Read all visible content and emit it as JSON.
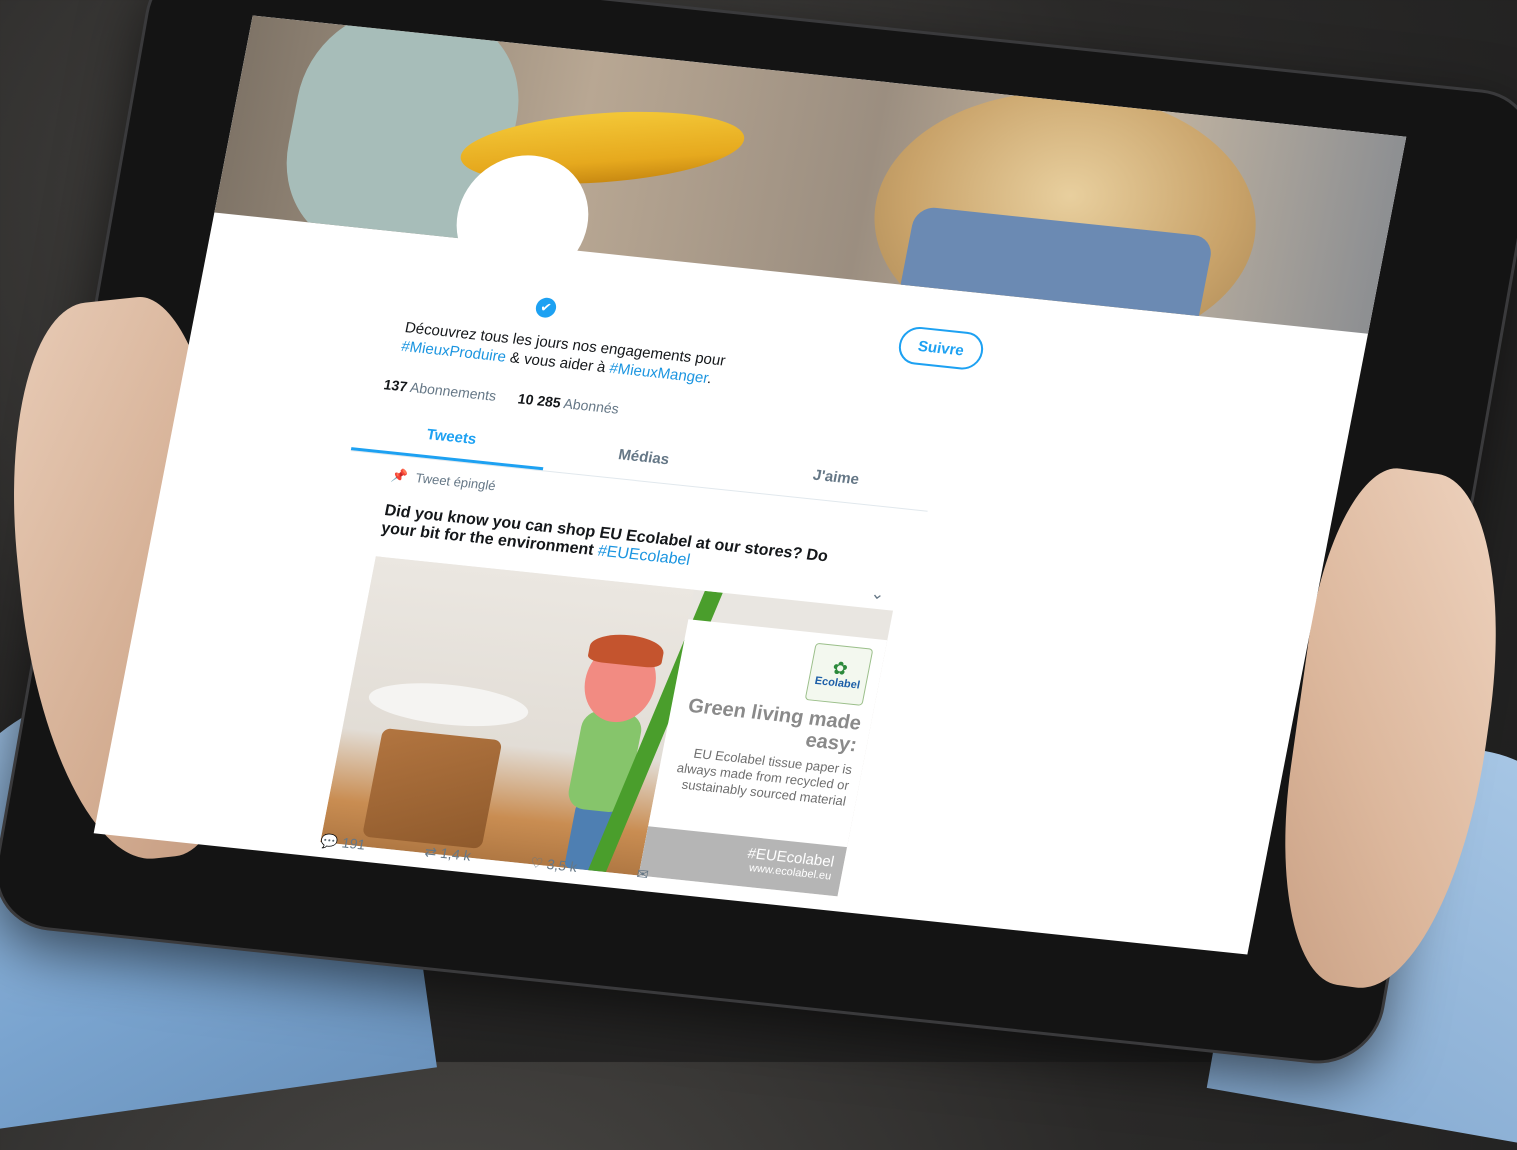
{
  "profile": {
    "follow_label": "Suivre",
    "verified_icon": "✔",
    "bio_line1": "Découvrez tous les jours nos engagements pour",
    "bio_hashtag1": "#MieuxProduire",
    "bio_mid": " & vous aider à ",
    "bio_hashtag2": "#MieuxManger",
    "bio_end": ".",
    "following_count": "137",
    "following_label": "Abonnements",
    "followers_count": "10 285",
    "followers_label": "Abonnés"
  },
  "tabs": [
    {
      "label": "Tweets",
      "active": true
    },
    {
      "label": "Médias",
      "active": false
    },
    {
      "label": "J'aime",
      "active": false
    }
  ],
  "pinned_label": "Tweet épinglé",
  "tweet": {
    "text": "Did you know you can shop EU Ecolabel at our stores? Do your bit for the environment",
    "hashtag": "#EUEcolabel",
    "media": {
      "logo_text": "Ecolabel",
      "headline": "Green living made easy:",
      "body": "EU Ecolabel tissue paper is always made from recycled or sustainably sourced material",
      "tag": "#EUEcolabel",
      "url": "www.ecolabel.eu"
    },
    "replies": "191",
    "retweets": "1,4 k",
    "likes": "3,5 k"
  }
}
